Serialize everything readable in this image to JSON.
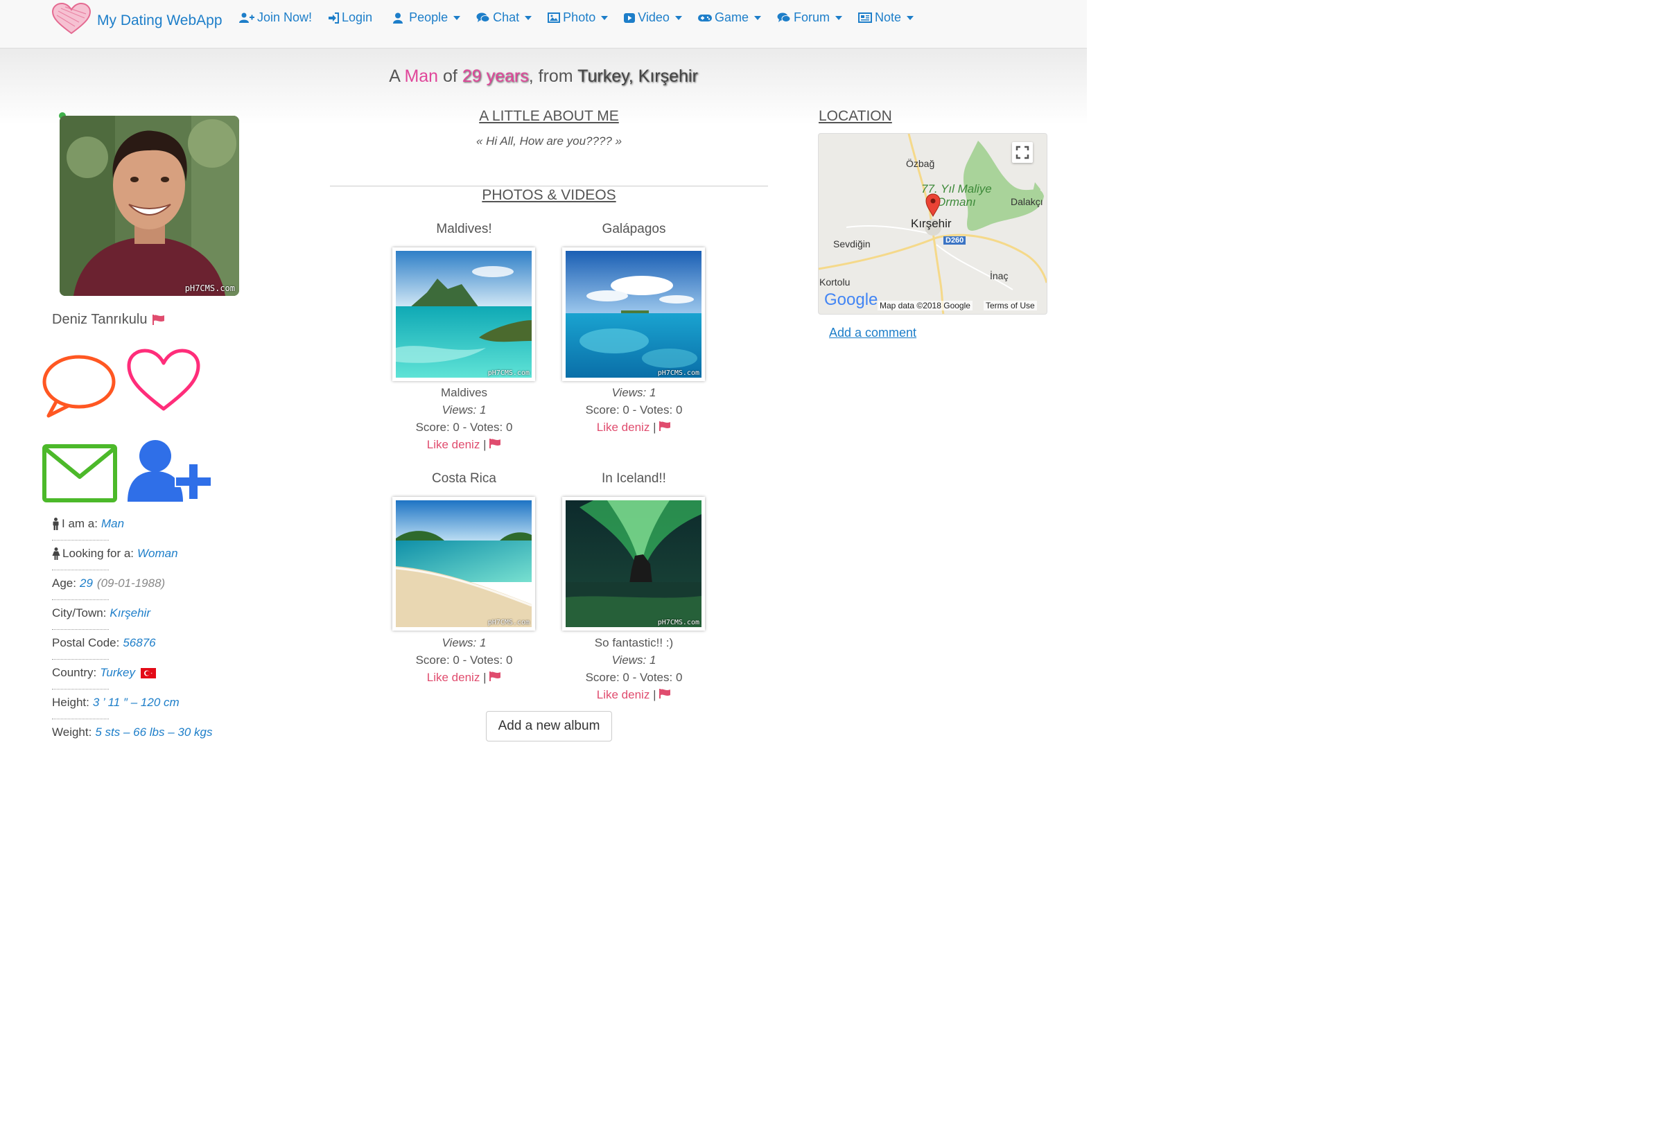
{
  "nav": {
    "brand": "My Dating WebApp",
    "items": [
      {
        "label": "Join Now!",
        "icon": "user-plus-icon",
        "dropdown": false
      },
      {
        "label": "Login",
        "icon": "sign-in-icon",
        "dropdown": false
      },
      {
        "label": "People",
        "icon": "user-icon",
        "dropdown": true
      },
      {
        "label": "Chat",
        "icon": "comments-icon",
        "dropdown": true
      },
      {
        "label": "Photo",
        "icon": "picture-icon",
        "dropdown": true
      },
      {
        "label": "Video",
        "icon": "play-icon",
        "dropdown": true
      },
      {
        "label": "Game",
        "icon": "gamepad-icon",
        "dropdown": true
      },
      {
        "label": "Forum",
        "icon": "comments-icon",
        "dropdown": true
      },
      {
        "label": "Note",
        "icon": "newspaper-icon",
        "dropdown": true
      }
    ]
  },
  "headline": {
    "prefix": "A",
    "sex": "Man",
    "of": "of",
    "age": "29 years",
    "comma_from": ", from",
    "location": "Turkey, Kırşehir"
  },
  "profile": {
    "name": "Deniz Tanrıkulu",
    "avatar_watermark": "pH7CMS.com",
    "info": [
      {
        "label": "I am a:",
        "value": "Man",
        "extra": "",
        "icon": "male-icon"
      },
      {
        "label": "Looking for a:",
        "value": "Woman",
        "extra": "",
        "icon": "female-icon"
      },
      {
        "label": "Age:",
        "value": "29",
        "extra": "(09-01-1988)",
        "icon": ""
      },
      {
        "label": "City/Town:",
        "value": "Kırşehir",
        "extra": "",
        "icon": ""
      },
      {
        "label": "Postal Code:",
        "value": "56876",
        "extra": "",
        "icon": ""
      },
      {
        "label": "Country:",
        "value": "Turkey",
        "extra": "",
        "icon": "turkey-flag-icon"
      },
      {
        "label": "Height:",
        "value": "3 ’ 11 ″ – 120 cm",
        "extra": "",
        "icon": ""
      },
      {
        "label": "Weight:",
        "value": "5 sts – 66 lbs – 30 kgs",
        "extra": "",
        "icon": ""
      }
    ]
  },
  "about": {
    "title": "A LITTLE ABOUT ME",
    "text": "« Hi All, How are you???? »"
  },
  "media": {
    "title": "PHOTOS & VIDEOS",
    "albums": [
      {
        "title": "Maldives!",
        "caption": "Maldives",
        "views": "Views: 1",
        "score": "Score: 0 - Votes: 0",
        "like": "Like deniz",
        "sep": "|",
        "watermark": "pH7CMS.com"
      },
      {
        "title": "Galápagos",
        "caption": "",
        "views": "Views: 1",
        "score": "Score: 0 - Votes: 0",
        "like": "Like deniz",
        "sep": "|",
        "watermark": "pH7CMS.com"
      },
      {
        "title": "Costa Rica",
        "caption": "",
        "views": "Views: 1",
        "score": "Score: 0 - Votes: 0",
        "like": "Like deniz",
        "sep": "|",
        "watermark": "pH7CMS.com"
      },
      {
        "title": "In Iceland!!",
        "caption": "So fantastic!! :)",
        "views": "Views: 1",
        "score": "Score: 0 - Votes: 0",
        "like": "Like deniz",
        "sep": "|",
        "watermark": "pH7CMS.com"
      }
    ],
    "add_album": "Add a new album"
  },
  "location": {
    "title": "LOCATION",
    "map": {
      "labels": [
        "Özbağ",
        "77. Yıl Maliye",
        "Ormanı",
        "Dalakçı",
        "Kırşehir",
        "D260",
        "Sevdiğin",
        "İnaç",
        "Kortolu"
      ],
      "google": "Google",
      "attribution": "Map data ©2018 Google",
      "terms": "Terms of Use"
    },
    "add_comment": "Add a comment"
  },
  "colors": {
    "link_blue": "#1d7ec9",
    "pink": "#e0469a",
    "like_red": "#e04c6e",
    "chat_orange": "#ff5722",
    "heart_pink": "#ff2d7a",
    "mail_green": "#4cb92a",
    "friend_blue": "#2f6fe8"
  }
}
